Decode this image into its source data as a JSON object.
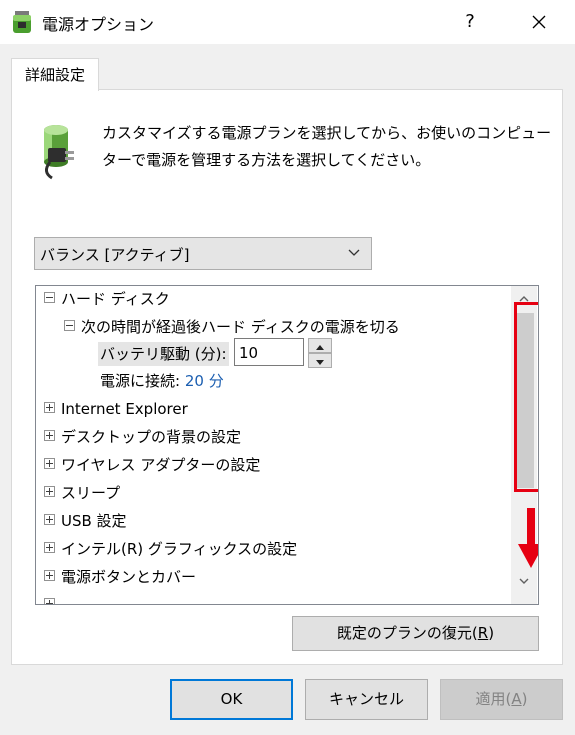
{
  "window": {
    "title": "電源オプション",
    "help": "?"
  },
  "tab": {
    "label": "詳細設定"
  },
  "description": {
    "line1": "カスタマイズする電源プランを選択してから、お使いのコンピュー",
    "line2": "ターで電源を管理する方法を選択してください。"
  },
  "plan_select": {
    "value": "バランス [アクティブ]"
  },
  "tree": {
    "items": [
      {
        "label": "ハード ディスク",
        "expanded": true
      },
      {
        "label": "次の時間が経過後ハード ディスクの電源を切る",
        "expanded": true
      },
      {
        "label": "Internet Explorer",
        "expanded": false
      },
      {
        "label": "デスクトップの背景の設定",
        "expanded": false
      },
      {
        "label": "ワイヤレス アダプターの設定",
        "expanded": false
      },
      {
        "label": "スリープ",
        "expanded": false
      },
      {
        "label": "USB 設定",
        "expanded": false
      },
      {
        "label": "インテル(R) グラフィックスの設定",
        "expanded": false
      },
      {
        "label": "電源ボタンとカバー",
        "expanded": false
      }
    ],
    "battery": {
      "label": "バッテリ駆動 (分):",
      "value": "10"
    },
    "plugged": {
      "label": "電源に接続:",
      "value": "20 分"
    }
  },
  "buttons": {
    "restore_main": "既定のプランの復元(",
    "restore_key": "R",
    "restore_end": ")",
    "ok": "OK",
    "cancel": "キャンセル",
    "apply_main": "適用(",
    "apply_key": "A",
    "apply_end": ")"
  },
  "colors": {
    "highlight_box": "#e60012",
    "link_value": "#1c5fb1",
    "ok_border": "#0078d7"
  },
  "icons": [
    "battery-plug-icon",
    "help-icon",
    "close-icon",
    "chevron-down-icon",
    "scroll-up-icon",
    "scroll-down-icon",
    "red-down-arrow-icon"
  ]
}
